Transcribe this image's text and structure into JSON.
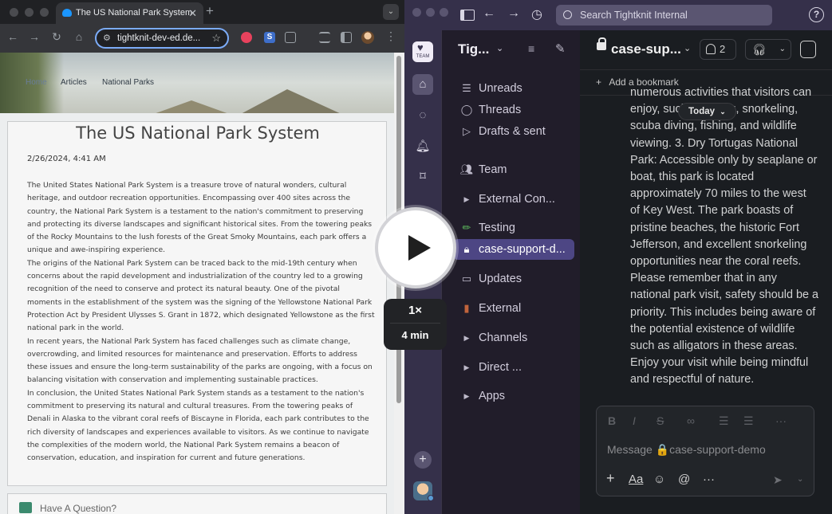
{
  "browser": {
    "tab_title": "The US National Park System",
    "address": "tightknit-dev-ed.de...",
    "breadcrumb": {
      "home": "Home",
      "articles": "Articles",
      "current": "National Parks"
    },
    "article": {
      "title": "The US National Park System",
      "date": "2/26/2024, 4:41 AM",
      "paragraphs": [
        "The United States National Park System is a treasure trove of natural wonders, cultural heritage, and outdoor recreation opportunities. Encompassing over 400 sites across the country, the National Park System is a testament to the nation's commitment to preserving and protecting its diverse landscapes and significant historical sites. From the towering peaks of the Rocky Mountains to the lush forests of the Great Smoky Mountains, each park offers a unique and awe-inspiring experience.",
        "The origins of the National Park System can be traced back to the mid-19th century when concerns about the rapid development and industrialization of the country led to a growing recognition of the need to conserve and protect its natural beauty. One of the pivotal moments in the establishment of the system was the signing of the Yellowstone National Park Protection Act by President Ulysses S. Grant in 1872, which designated Yellowstone as the first national park in the world.",
        "In recent years, the National Park System has faced challenges such as climate change, overcrowding, and limited resources for maintenance and preservation. Efforts to address these issues and ensure the long-term sustainability of the parks are ongoing, with a focus on balancing visitation with conservation and implementing sustainable practices.",
        "In conclusion, the United States National Park System stands as a testament to the nation's commitment to preserving its natural and cultural treasures. From the towering peaks of Denali in Alaska to the vibrant coral reefs of Biscayne in Florida, each park contributes to the rich diversity of landscapes and experiences available to visitors. As we continue to navigate the complexities of the modern world, the National Park System remains a beacon of conservation, education, and inspiration for current and future generations."
      ]
    },
    "question_label": "Have A Question?"
  },
  "slack": {
    "search_placeholder": "Search Tightknit Internal",
    "workspace_name": "Tig...",
    "rail_logo_text": "TEAM",
    "nav": {
      "unreads": "Unreads",
      "threads": "Threads",
      "drafts": "Drafts & sent",
      "team": "Team",
      "external_con": "External Con...",
      "testing": "Testing",
      "case_support": "case-support-d...",
      "updates": "Updates",
      "external": "External",
      "channels": "Channels",
      "direct": "Direct ...",
      "apps": "Apps"
    },
    "channel": {
      "title": "case-sup...",
      "member_count": "2",
      "bookmark": "Add a bookmark",
      "date_divider": "Today",
      "message": "numerous activities that visitors can enjoy, such as hiking, snorkeling, scuba diving, fishing, and wildlife viewing. 3. Dry Tortugas National Park: Accessible only by seaplane or boat, this park is located approximately 70 miles to the west of Key West. The park boasts of pristine beaches, the historic Fort Jefferson, and excellent snorkeling opportunities near the coral reefs. Please remember that in any national park visit, safety should be a priority. This includes being aware of the potential existence of wildlife such as alligators in these areas. Enjoy your visit while being mindful and respectful of nature.",
      "composer_placeholder": "Message 🔒case-support-demo"
    }
  },
  "video": {
    "speed": "1×",
    "duration": "4 min"
  }
}
